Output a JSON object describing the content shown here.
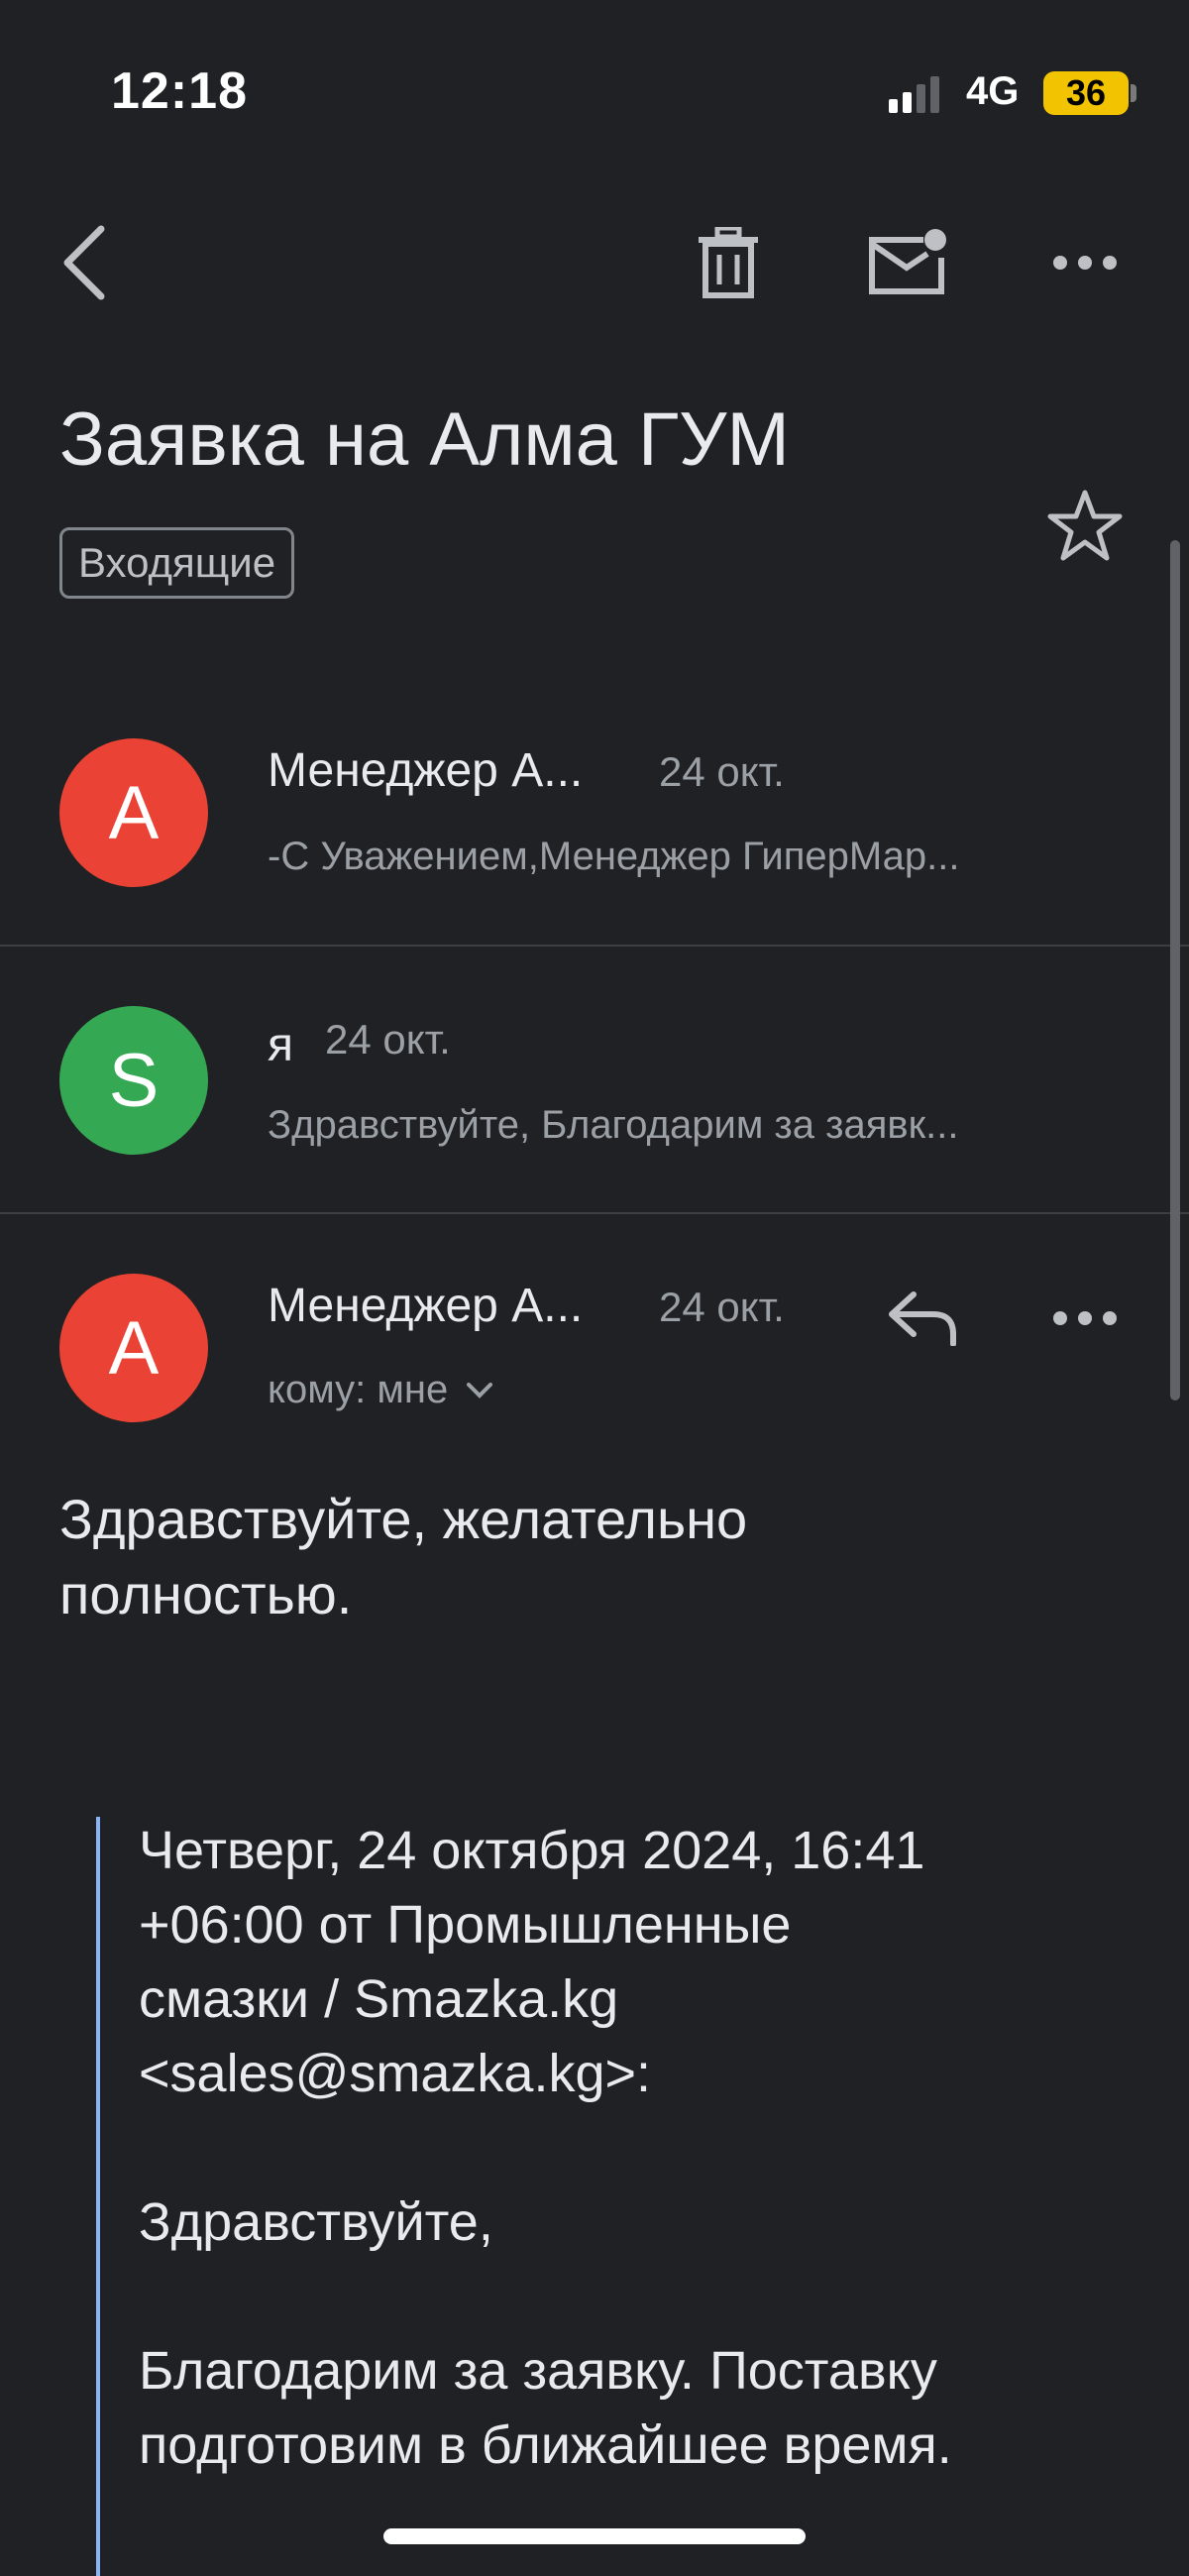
{
  "status_bar": {
    "time": "12:18",
    "network": "4G",
    "battery": "36"
  },
  "subject": "Заявка на Алма ГУМ",
  "label": "Входящие",
  "thread": [
    {
      "avatar_letter": "A",
      "avatar_color": "#ea4335",
      "sender": "Менеджер А...",
      "date": "24 окт.",
      "snippet": "-С Уважением,Менеджер ГиперМар..."
    },
    {
      "avatar_letter": "S",
      "avatar_color": "#34a853",
      "sender": "я",
      "date": "24 окт.",
      "snippet": "Здравствуйте, Благодарим за заявк..."
    }
  ],
  "open_message": {
    "avatar_letter": "A",
    "avatar_color": "#ea4335",
    "sender": "Менеджер А...",
    "date": "24 окт.",
    "recipient": "кому: мне",
    "body_lines": [
      "Здравствуйте, желательно",
      "полностью."
    ],
    "quote": {
      "header_lines": [
        "Четверг, 24 октября 2024, 16:41",
        "+06:00 от Промышленные",
        "смазки / Smazka.kg",
        "<sales@smazka.kg>:"
      ],
      "greeting": "Здравствуйте,",
      "text_lines": [
        "Благодарим за заявку. Поставку",
        "подготовим в ближайшее время."
      ]
    }
  },
  "icons": {
    "back": "back-arrow-icon",
    "trash": "trash-icon",
    "mail": "mark-unread-icon",
    "more": "more-horizontal-icon",
    "star": "star-icon",
    "reply": "reply-icon",
    "expand": "chevron-down-icon"
  }
}
